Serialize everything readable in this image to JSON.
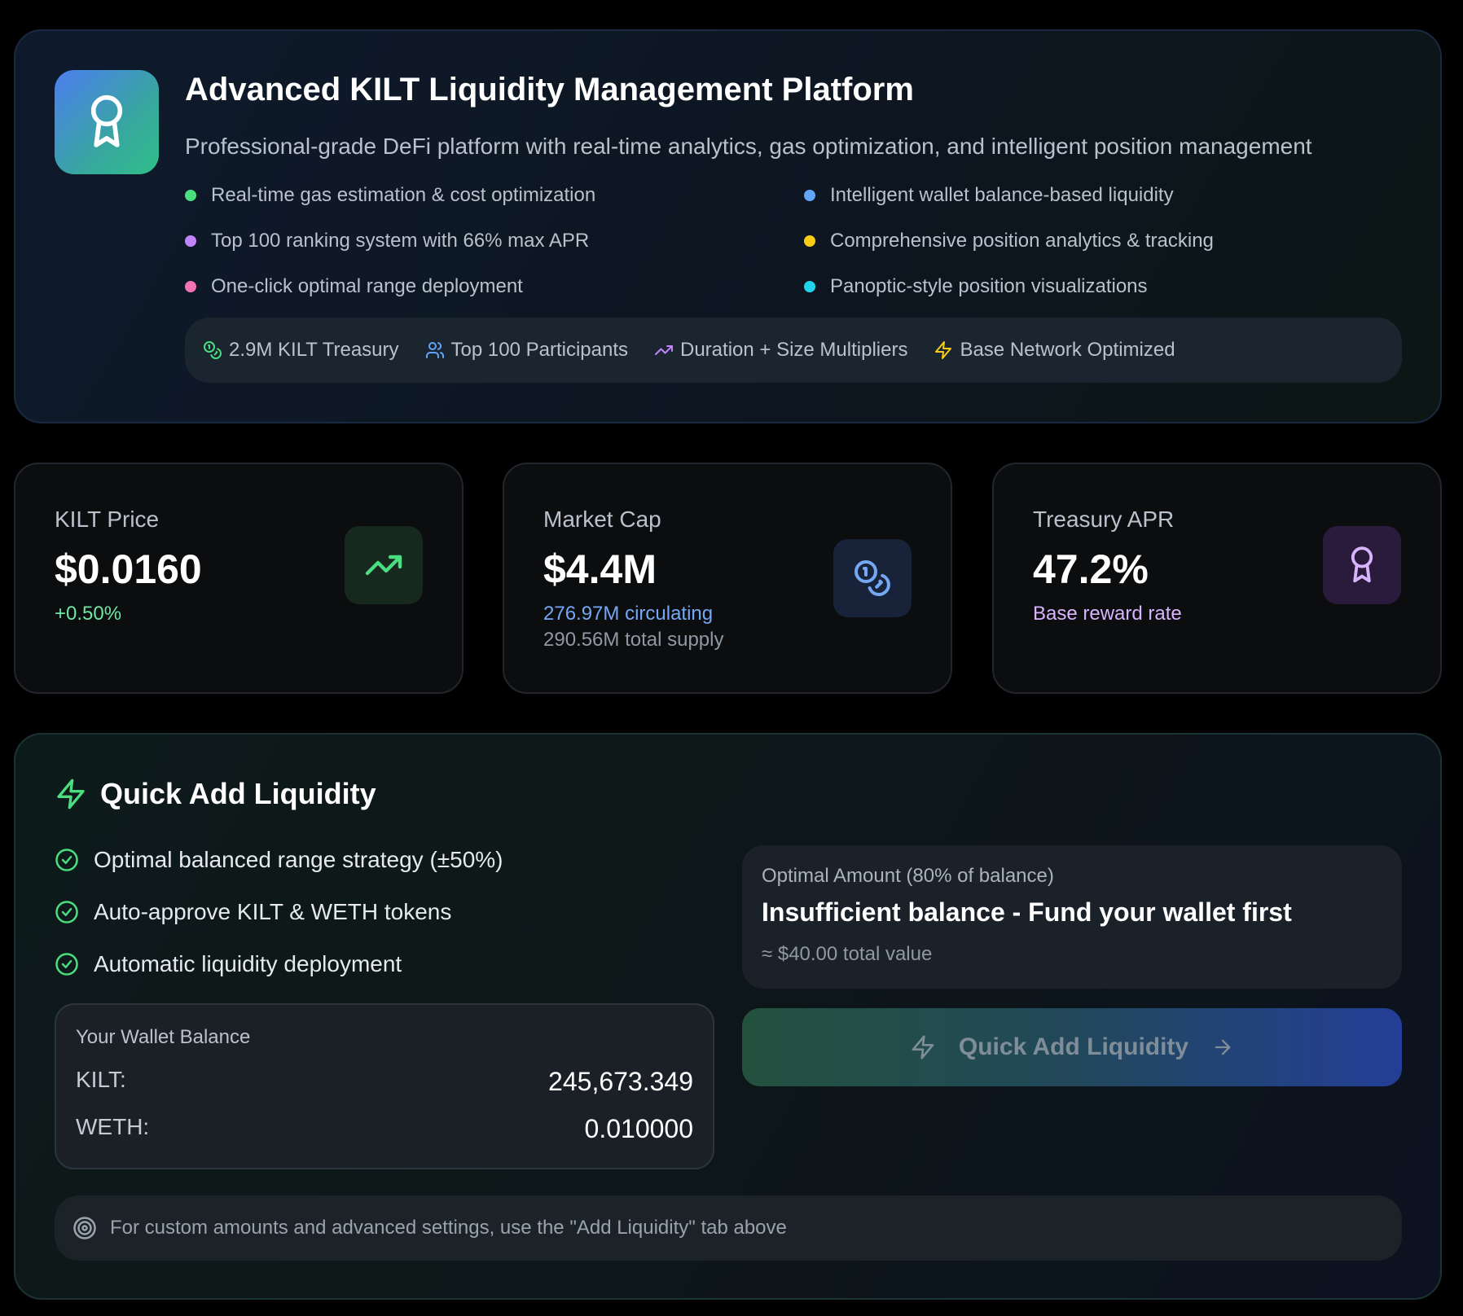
{
  "hero": {
    "title": "Advanced KILT Liquidity Management Platform",
    "subtitle": "Professional-grade DeFi platform with real-time analytics, gas optimization, and intelligent position management",
    "features": [
      {
        "label": "Real-time gas estimation & cost optimization",
        "color": "#4ade80"
      },
      {
        "label": "Intelligent wallet balance-based liquidity",
        "color": "#60a5fa"
      },
      {
        "label": "Top 100 ranking system with 66% max APR",
        "color": "#c084fc"
      },
      {
        "label": "Comprehensive position analytics & tracking",
        "color": "#facc15"
      },
      {
        "label": "One-click optimal range deployment",
        "color": "#f472b6"
      },
      {
        "label": "Panoptic-style position visualizations",
        "color": "#22d3ee"
      }
    ],
    "highlights": [
      {
        "icon": "coins-icon",
        "label": "2.9M KILT Treasury",
        "color": "#4ade80"
      },
      {
        "icon": "users-icon",
        "label": "Top 100 Participants",
        "color": "#60a5fa"
      },
      {
        "icon": "trending-up-icon",
        "label": "Duration + Size Multipliers",
        "color": "#c084fc"
      },
      {
        "icon": "zap-icon",
        "label": "Base Network Optimized",
        "color": "#facc15"
      }
    ]
  },
  "stats": {
    "price": {
      "label": "KILT Price",
      "value": "$0.0160",
      "change": "+0.50%",
      "change_color": "#6ee7a4",
      "icon": "trending-up-icon"
    },
    "market_cap": {
      "label": "Market Cap",
      "value": "$4.4M",
      "circulating": "276.97M circulating",
      "total_supply": "290.56M total supply",
      "icon": "coins-icon"
    },
    "apr": {
      "label": "Treasury APR",
      "value": "47.2%",
      "sub": "Base reward rate",
      "icon": "award-icon"
    }
  },
  "quick_add": {
    "title": "Quick Add Liquidity",
    "checks": [
      "Optimal balanced range strategy (±50%)",
      "Auto-approve KILT & WETH tokens",
      "Automatic liquidity deployment"
    ],
    "wallet": {
      "title": "Your Wallet Balance",
      "rows": [
        {
          "token": "KILT:",
          "amount": "245,673.349"
        },
        {
          "token": "WETH:",
          "amount": "0.010000"
        }
      ]
    },
    "optimal": {
      "label": "Optimal Amount (80% of balance)",
      "message": "Insufficient balance - Fund your wallet first",
      "value": "≈ $40.00 total value"
    },
    "button_label": "Quick Add Liquidity",
    "tip": "For custom amounts and advanced settings, use the \"Add Liquidity\" tab above"
  },
  "colors": {
    "accent_green": "#4ade80",
    "accent_blue": "#60a5fa",
    "accent_purple": "#c084fc"
  }
}
